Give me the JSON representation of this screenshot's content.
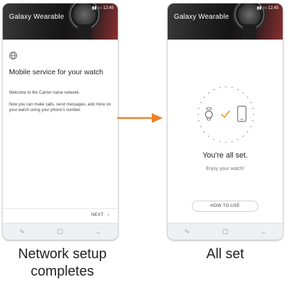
{
  "app_title": "Galaxy Wearable",
  "status_time": "12:45",
  "colors": {
    "accent_orange": "#F0812A",
    "check_orange": "#F09A2E",
    "header_dark": "#1a1a1a"
  },
  "left_screen": {
    "icon": "globe-icon",
    "title": "Mobile service for your watch",
    "paragraph1": "Welcome to the Carrier name network.",
    "paragraph2": "Now you can make calls, send messages, and more on your watch using your phone's number.",
    "next_label": "NEXT"
  },
  "right_screen": {
    "icons": [
      "watch-icon",
      "check-icon",
      "phone-icon"
    ],
    "title": "You're all set.",
    "subtitle": "Enjoy your watch!",
    "button_label": "HOW TO USE"
  },
  "navbar_icons": [
    "recents-icon",
    "home-icon",
    "back-icon"
  ],
  "captions": {
    "left": "Network setup completes",
    "right": "All set"
  }
}
